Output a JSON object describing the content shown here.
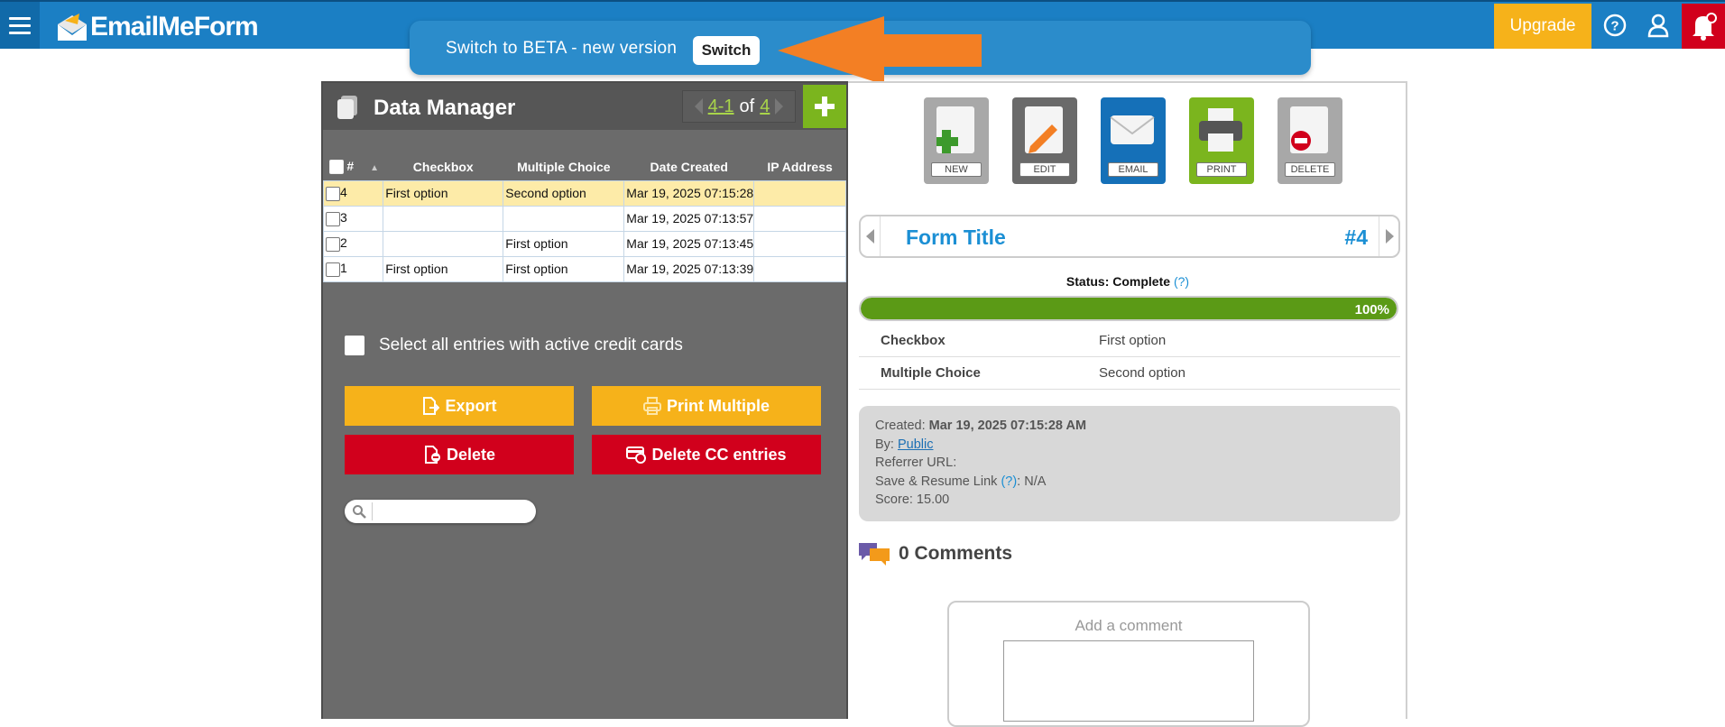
{
  "topbar": {
    "brand": "EmailMeForm",
    "upgrade_label": "Upgrade",
    "icons": [
      "menu-icon",
      "help-icon",
      "user-icon",
      "bell-icon"
    ],
    "brand_color": "#1b7fc4"
  },
  "beta_banner": {
    "text": "Switch to BETA - new version",
    "switch_label": "Switch"
  },
  "data_manager": {
    "title": "Data Manager",
    "pager": {
      "range": "4-1",
      "of": "of",
      "total": "4"
    },
    "columns": [
      "#",
      "Checkbox",
      "Multiple Choice",
      "Date Created",
      "IP Address"
    ],
    "rows": [
      {
        "num": "4",
        "checkbox": "First option",
        "multiple_choice": "Second option",
        "date": "Mar 19, 2025 07:15:28",
        "ip": ""
      },
      {
        "num": "3",
        "checkbox": "",
        "multiple_choice": "",
        "date": "Mar 19, 2025 07:13:57",
        "ip": ""
      },
      {
        "num": "2",
        "checkbox": "",
        "multiple_choice": "First option",
        "date": "Mar 19, 2025 07:13:45",
        "ip": ""
      },
      {
        "num": "1",
        "checkbox": "First option",
        "multiple_choice": "First option",
        "date": "Mar 19, 2025 07:13:39",
        "ip": ""
      }
    ],
    "select_all_label": "Select all entries with active credit cards",
    "buttons": {
      "export": "Export",
      "print_multiple": "Print Multiple",
      "delete": "Delete",
      "delete_cc": "Delete CC entries"
    },
    "search_value": ""
  },
  "detail": {
    "toolbar": [
      "NEW",
      "EDIT",
      "EMAIL",
      "PRINT",
      "DELETE"
    ],
    "form_title": "Form Title",
    "entry_number": "#4",
    "status_label": "Status: Complete",
    "status_help": "(?)",
    "progress": 1.0,
    "progress_label": "100%",
    "fields": [
      {
        "key": "Checkbox",
        "value": "First option"
      },
      {
        "key": "Multiple Choice",
        "value": "Second option"
      }
    ],
    "meta": {
      "created_label": "Created:",
      "created_value": "Mar 19, 2025 07:15:28 AM",
      "by_label": "By:",
      "by_value": "Public",
      "referrer_label": "Referrer URL:",
      "save_resume_label": "Save & Resume Link",
      "save_resume_help": "(?)",
      "save_resume_value": ": N/A",
      "score_label": "Score: 15.00"
    },
    "comments_label": "0 Comments",
    "comment_placeholder": "Add a comment"
  }
}
